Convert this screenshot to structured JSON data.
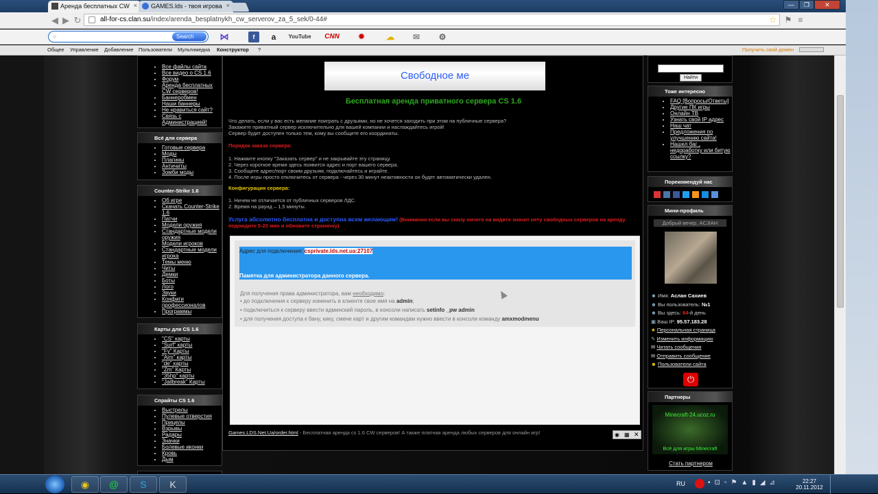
{
  "tabs": [
    {
      "label": "Аренда бесплатных CW"
    },
    {
      "label": "GAMES.lds - твоя игрова"
    }
  ],
  "window": {
    "min": "—",
    "max": "❐",
    "close": "✕"
  },
  "address": {
    "host": "all-for-cs.clan.su",
    "path": "/index/arenda_besplatnykh_cw_serverov_za_5_sek/0-44#"
  },
  "addons": {
    "search_label": "Search",
    "youtube": "YouTube",
    "cnn": "CNN"
  },
  "ucoz_bar": {
    "items": [
      "Общее",
      "Управление",
      "Добавление",
      "Пользователи",
      "Мультимедиа",
      "Конструктор",
      "?"
    ],
    "right": "Получить свой домен"
  },
  "left_blocks": [
    {
      "title": "",
      "items": [
        "Все файлы сайта",
        "Все видео о CS 1.6",
        "Форум",
        "Аренда бесплатных CW серверов!",
        "Баннеробмен",
        "Наши баннеры",
        "Не нравиться сайт?",
        "Связь с Администрацией!"
      ]
    },
    {
      "title": "Всё для сервера",
      "items": [
        "Готовые сервера",
        "Моды",
        "Плагины",
        "Античиты",
        "Зомби моды"
      ]
    },
    {
      "title": "Counter-Strike 1.6",
      "items": [
        "Об игре",
        "Скачать Counter-Strike 1.6",
        "Патчи",
        "Модели оружия",
        "Стандартные модели оружия",
        "Модели игроков",
        "Стандартные модели игрока",
        "Темы меню",
        "Читы",
        "Демки",
        "Боты",
        "Лого",
        "Звуки",
        "Конфиги профессионалов",
        "Программы"
      ]
    },
    {
      "title": "Карты для CS 1.6",
      "items": [
        "\"CS\" карты",
        "\"Surf\" карты",
        "\"Fy\" Карты",
        "\"Aim\" карты",
        "\"de\" карты",
        "\"Zm\" Карты",
        "\"35hp\" карты",
        "\"Jailbreak\" Карты"
      ]
    },
    {
      "title": "Спрайты CS 1.6",
      "items": [
        "Выстрелы",
        "Пулевые отверстия",
        "Прицелы",
        "Взрывы",
        "Радары",
        "Значки",
        "Болевые иконки",
        "Кровь",
        "Дым"
      ]
    }
  ],
  "main": {
    "ad_text": "Свободное ме",
    "title": "Бесплатная аренда приватного сервера CS 1.6",
    "intro": [
      "Что делать, если у вас есть желание поиграть с друзьями, но не хочется заходить при этом на публичные сервера?",
      "Закажите приватный сервер исключительно для вашей компании и наслаждайтесь игрой!",
      "Сервер будет доступен только тем, кому вы сообщите его координаты."
    ],
    "order_title": "Порядок заказа сервера:",
    "steps": [
      "1. Нажмите кнопку \"Заказать сервер\" и не закрывайте эту страницу.",
      "2. Через короткое время здесь появится адрес и порт вашего сервера.",
      "3. Сообщите адрес/порт своим друзьям, подключайтесь и играйте.",
      "4. После игры просто отключитесь от сервера - через 30 минут неактивности он будет автоматически удален."
    ],
    "config_title": "Конфигурация сервера:",
    "config": [
      "1. Ничем не отличается от публичных серверов ЛДС.",
      "2. Время на раунд – 1,5 минуты."
    ],
    "free_note": "Услуга абсолютно бесплатна и доступна всем желающим!",
    "warn": "(Внимания если вы снизу ничего на видите значит нету свободных серверов на аренду подождите 5-20 мин и обновите страничку)",
    "addr_label": "Адрес для подключения:",
    "addr_value": "csprivate.lds.net.ua:27107",
    "memo": "Памятка для администратора данного сервера.",
    "admin_intro": "Для получения права администратора, вам",
    "admin_intro_link": "необходимо",
    "b1": "• до подключения к серверу изменить в клиенте свое имя на",
    "b1_bold": "admin",
    "b2": "• подключиться к серверу ввести админский пароль, в консоли написать",
    "b2_bold": "setinfo _pw admin",
    "b3": "• для получения доступа к бану, кику, смене карт и другим командам нужно ввести в консоли команду",
    "b3_bold": "amxmodmenu",
    "footer_link": "Games.LDS.Net.Ua/order.html",
    "footer_text": "- Бесплатная аренда cs 1.6 CW серверов! А также платная аренда любых серверов для онлайн игр!"
  },
  "right": {
    "search_button": "Найти",
    "interest_title": "Тоже интересно",
    "interest": [
      "FAQ [Вопросы/Ответы]",
      "Другие ПК игры",
      "Онлайн ТВ",
      "Узнать свой IP адрес",
      "Наш чат",
      "Предложения по улучшению сайта!",
      "Нашел баг , недоработку или битую ссылку?"
    ],
    "recommend_title": "Порекомендуй нас",
    "profile_title": "Мини-профиль",
    "greeting": "Добрый вечер, ACJIAH",
    "name_label": "Имя:",
    "name": "Аслан Сахиев",
    "you_label": "Вы пользователь:",
    "you": "№1",
    "here_label": "Вы здесь:",
    "here_days": "64",
    "here_unit": "-й день",
    "ip_label": "Ваш IP:",
    "ip": "95.57.183.28",
    "links": [
      "Персональная страница",
      "Изменить информацию",
      "Читать сообщения",
      "Отправить сообщение",
      "Пользователи сайта"
    ],
    "partners_title": "Партнеры",
    "partner_top": "Minecraft-24.ucoz.ru",
    "partner_bottom": "Всё для игры Minecraft",
    "partners_link": "Стать партнером"
  },
  "taskbar": {
    "lang": "RU",
    "time": "22:27",
    "date": "20.11.2012"
  }
}
